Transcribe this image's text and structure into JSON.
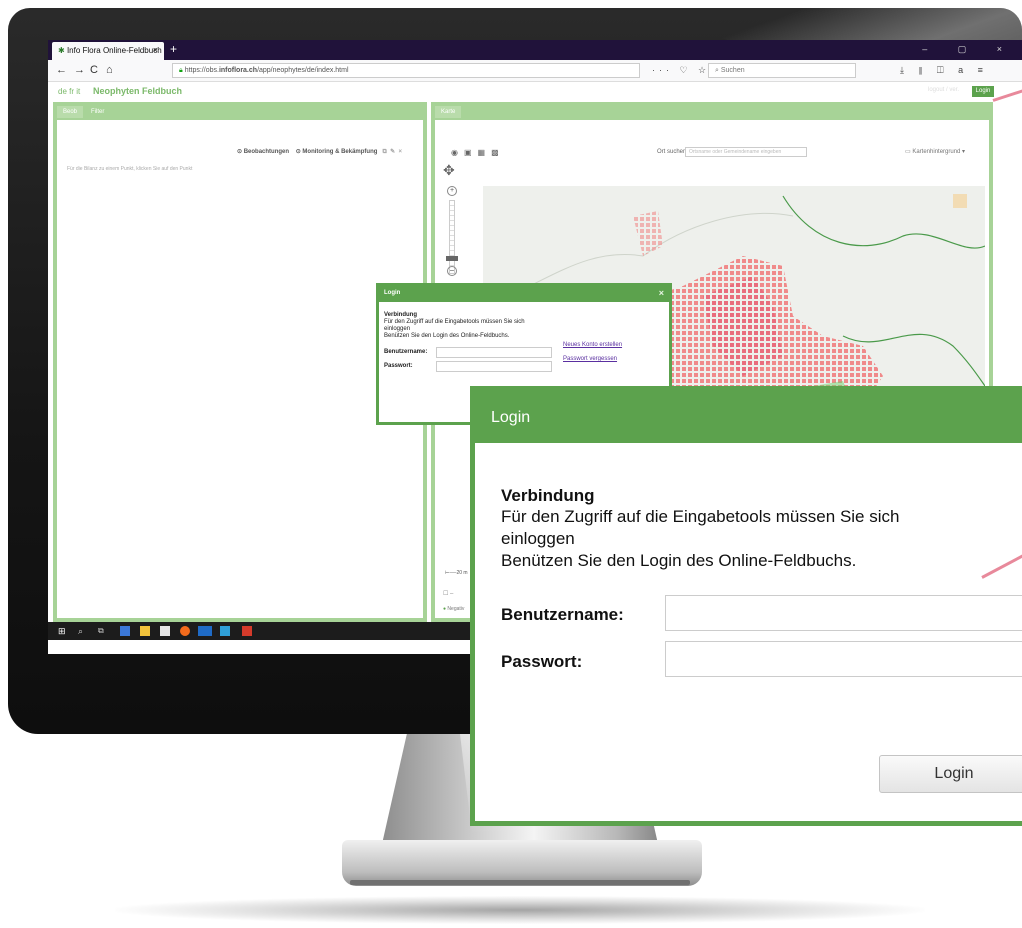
{
  "browser": {
    "tab_title": "Info Flora Online-Feldbuch",
    "tab_close": "×",
    "new_tab": "+",
    "window_controls": "– ▢ ×",
    "back": "←",
    "forward": "→",
    "reload": "C",
    "home": "⌂",
    "url_prefix": "https://obs.",
    "url_domain": "infoflora.ch",
    "url_path": "/app/neophytes/de/index.html",
    "page_actions": "··· ♡ ☆",
    "search_placeholder": "Suchen",
    "toolbar_icons": "⤓ ⫴ ◫ a ≡"
  },
  "app": {
    "languages": "de fr it",
    "title": "Neophyten Feldbuch",
    "version_text": "logout / ver.",
    "login_button": "Login"
  },
  "left_panel": {
    "tabs": [
      "Beob",
      "Filter"
    ],
    "observations_button": "Beobachtungen",
    "monitoring_button": "Monitoring & Bekämpfung",
    "hint": "Für die Bilanz zu einem Punkt, klicken Sie auf den Punkt"
  },
  "right_panel": {
    "tab": "Karte",
    "ort_suchen_label": "Ort suchen",
    "ort_suchen_placeholder": "Ortsname oder Gemeindename eingeben",
    "background_select": "Kartenhintergrund",
    "scale_label": "20 m",
    "legend_negative": "Negativ"
  },
  "small_dialog": {
    "title": "Login",
    "close": "×",
    "heading": "Verbindung",
    "line1": "Für den Zugriff auf die Eingabetools müssen Sie sich",
    "line2": "einloggen",
    "line3": "Benützen Sie den Login des Online-Feldbuchs.",
    "new_account_link": "Neues Konto erstellen",
    "forgot_password_link": "Passwort vergessen",
    "username_label": "Benutzername:",
    "password_label": "Passwort:"
  },
  "big_dialog": {
    "title": "Login",
    "heading": "Verbindung",
    "line1": "Für den Zugriff auf die Eingabetools müssen Sie sich",
    "line2": "einloggen",
    "line3": "Benützen Sie den Login des Online-Feldbuchs.",
    "username_label": "Benutzername:",
    "password_label": "Passwort:",
    "login_button": "Login"
  },
  "colors": {
    "brand_green": "#5ca24d",
    "panel_green": "#a7d397",
    "arrow_pink": "#e8899b",
    "map_distribution": "#f08a8a"
  }
}
